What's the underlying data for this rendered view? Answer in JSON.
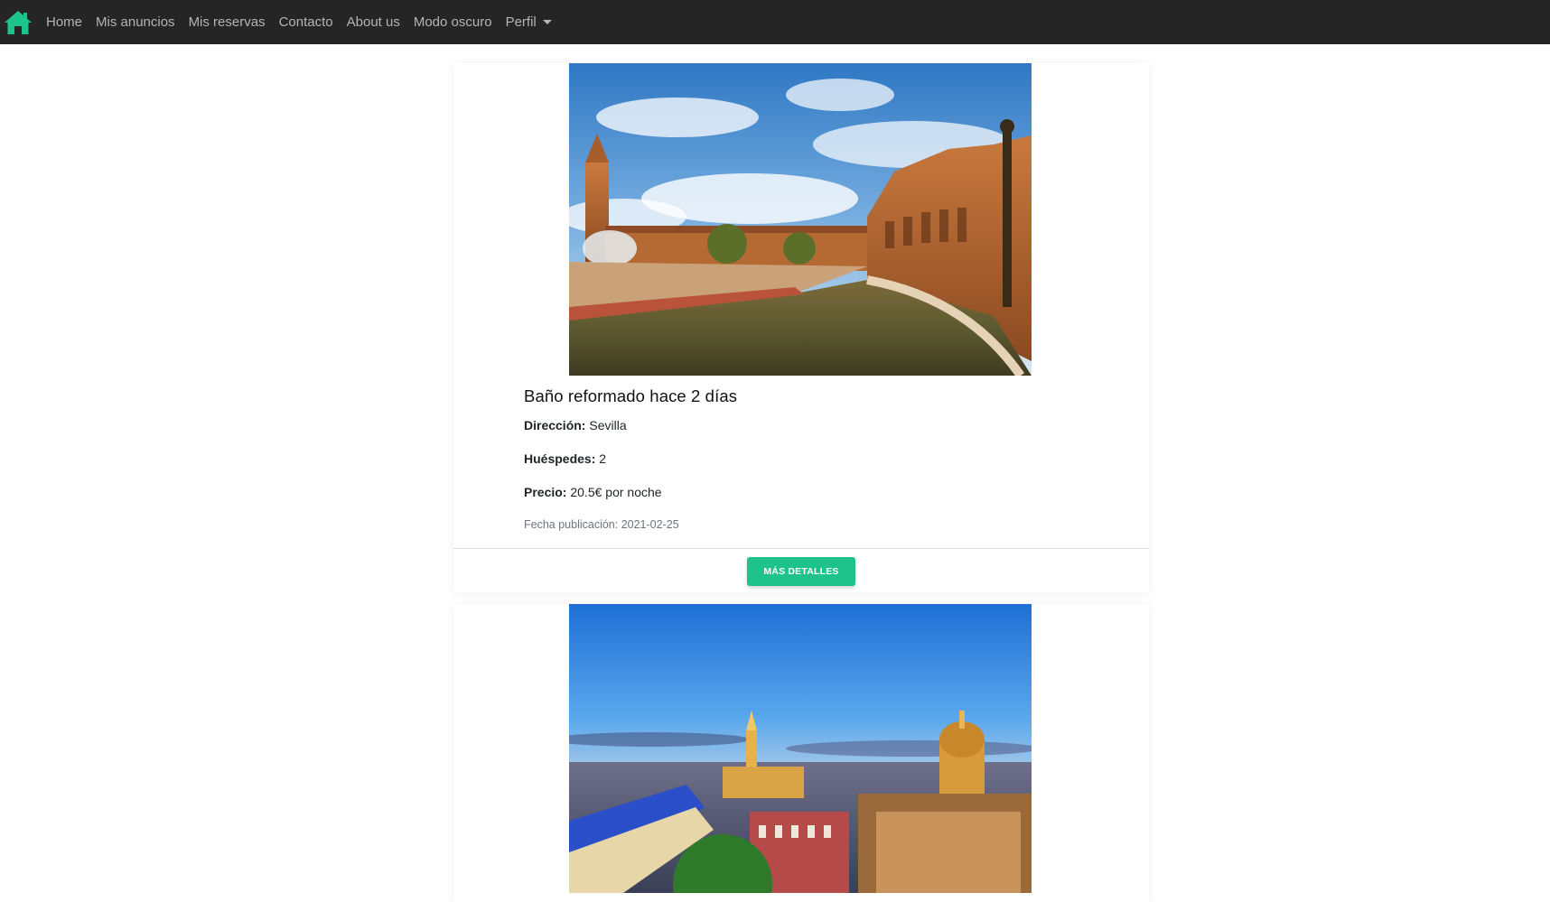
{
  "nav": {
    "brand_icon": "home-icon",
    "brand_color": "#1ec28b",
    "items": [
      {
        "label": "Home"
      },
      {
        "label": "Mis anuncios"
      },
      {
        "label": "Mis reservas"
      },
      {
        "label": "Contacto"
      },
      {
        "label": "About us"
      },
      {
        "label": "Modo oscuro"
      },
      {
        "label": "Perfil"
      }
    ]
  },
  "listings": [
    {
      "title": "Baño reformado hace 2 días",
      "address_label": "Dirección:",
      "address": "Sevilla",
      "guests_label": "Huéspedes:",
      "guests": "2",
      "price_label": "Precio:",
      "price": "20.5€ por noche",
      "date": "Fecha publicación: 2021-02-25",
      "button": "MÁS DETALLES"
    }
  ],
  "colors": {
    "navbar": "#252525",
    "accent": "#1ec28b"
  }
}
